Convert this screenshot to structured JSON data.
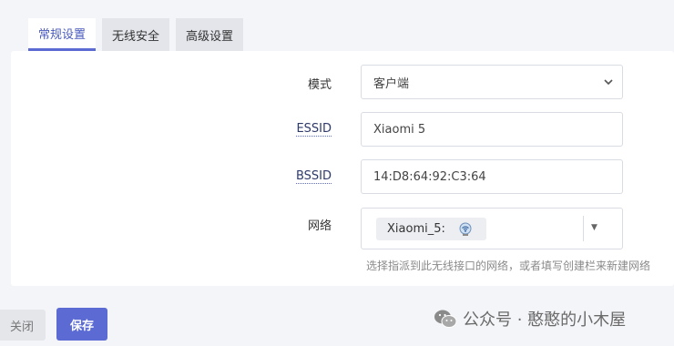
{
  "tabs": [
    {
      "label": "常规设置",
      "active": true
    },
    {
      "label": "无线安全",
      "active": false
    },
    {
      "label": "高级设置",
      "active": false
    }
  ],
  "form": {
    "mode": {
      "label": "模式",
      "value": "客户端"
    },
    "essid": {
      "label": "ESSID",
      "value": "Xiaomi 5"
    },
    "bssid": {
      "label": "BSSID",
      "value": "14:D8:64:92:C3:64"
    },
    "network": {
      "label": "网络",
      "chip": "Xiaomi_5:",
      "chip_icon": "wireless-network-icon",
      "hint": "选择指派到此无线接口的网络，或者填写创建栏来新建网络"
    }
  },
  "buttons": {
    "close": "关闭",
    "save": "保存"
  },
  "watermark": "公众号 · 憨憨的小木屋",
  "colors": {
    "accent": "#5b6bd3",
    "tab_active_text": "#4a5bbd"
  }
}
